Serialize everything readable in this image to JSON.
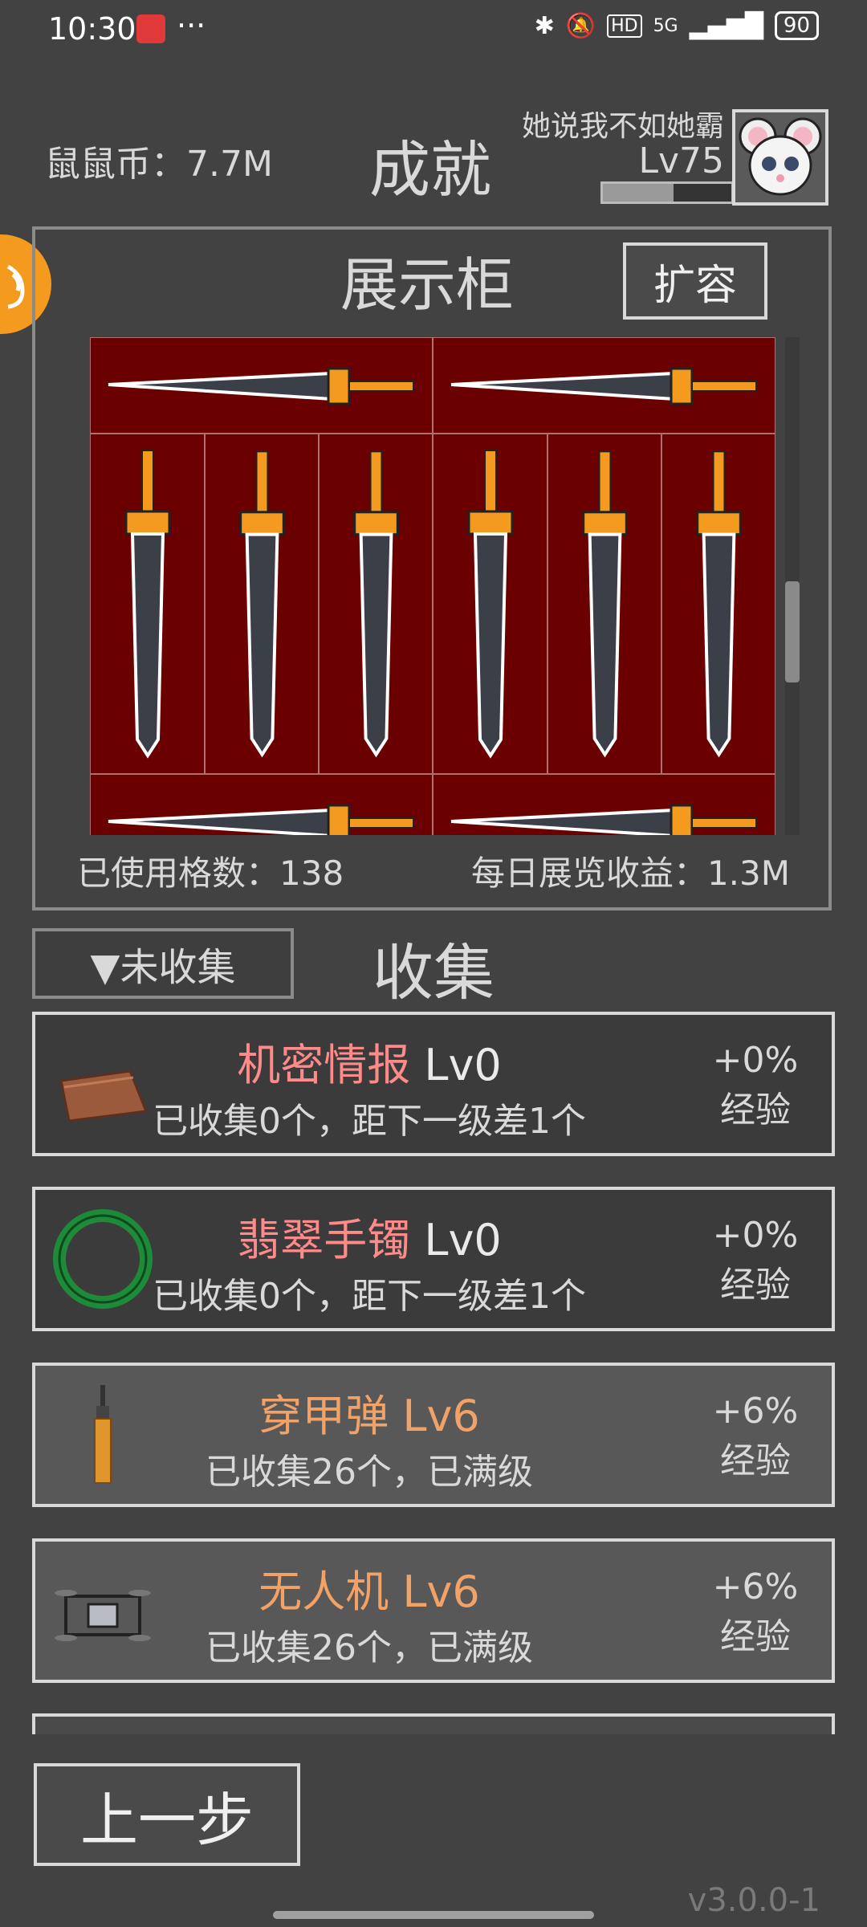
{
  "status_bar": {
    "time": "10:30",
    "dots": "···",
    "icons": [
      "bluetooth-icon",
      "bell-off-icon",
      "hd-icon",
      "signal-icon"
    ],
    "network": "5G",
    "battery": "90"
  },
  "header": {
    "coins": "鼠鼠币：7.7M",
    "title": "成就",
    "username": "她说我不如她霸",
    "level": "Lv75",
    "xp_progress": 0.55
  },
  "cabinet": {
    "title": "展示柜",
    "expand_label": "扩容",
    "used_slots": "已使用格数：138",
    "daily_income": "每日展览收益：1.3M"
  },
  "collection": {
    "filter_label": "▼未收集",
    "title": "收集",
    "items": [
      {
        "name": "机密情报",
        "level": "Lv0",
        "progress": "已收集0个，距下一级差1个",
        "bonus": "+0%",
        "bonus_label": "经验",
        "icon": "folder-icon"
      },
      {
        "name": "翡翠手镯",
        "level": "Lv0",
        "progress": "已收集0个，距下一级差1个",
        "bonus": "+0%",
        "bonus_label": "经验",
        "icon": "bracelet-icon"
      },
      {
        "name": "穿甲弹",
        "level": "Lv6",
        "progress": "已收集26个，已满级",
        "bonus": "+6%",
        "bonus_label": "经验",
        "icon": "bullet-icon"
      },
      {
        "name": "无人机",
        "level": "Lv6",
        "progress": "已收集26个，已满级",
        "bonus": "+6%",
        "bonus_label": "经验",
        "icon": "drone-icon"
      }
    ]
  },
  "footer": {
    "back_label": "上一步",
    "version": "v3.0.0-1"
  }
}
